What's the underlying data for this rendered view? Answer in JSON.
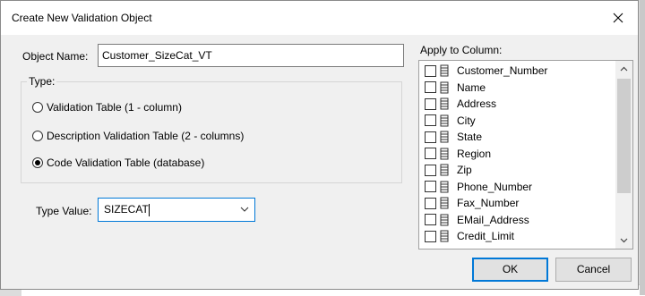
{
  "dialog": {
    "title": "Create New Validation Object"
  },
  "object_name": {
    "label": "Object Name:",
    "value": "Customer_SizeCat_VT"
  },
  "type_group": {
    "label": "Type:",
    "options": [
      {
        "label": "Validation Table (1 - column)",
        "checked": false
      },
      {
        "label": "Description Validation Table (2 - columns)",
        "checked": false
      },
      {
        "label": "Code Validation Table (database)",
        "checked": true
      }
    ]
  },
  "type_value": {
    "label": "Type Value:",
    "value": "SIZECAT"
  },
  "apply_to_column": {
    "label": "Apply to Column:",
    "items": [
      {
        "label": "Customer_Number",
        "checked": false
      },
      {
        "label": "Name",
        "checked": false
      },
      {
        "label": "Address",
        "checked": false
      },
      {
        "label": "City",
        "checked": false
      },
      {
        "label": "State",
        "checked": false
      },
      {
        "label": "Region",
        "checked": false
      },
      {
        "label": "Zip",
        "checked": false
      },
      {
        "label": "Phone_Number",
        "checked": false
      },
      {
        "label": "Fax_Number",
        "checked": false
      },
      {
        "label": "EMail_Address",
        "checked": false
      },
      {
        "label": "Credit_Limit",
        "checked": false
      }
    ]
  },
  "buttons": {
    "ok": "OK",
    "cancel": "Cancel"
  },
  "icons": {
    "close": "close-icon",
    "column": "column-icon",
    "dropdown": "chevron-down-icon",
    "scroll_up": "chevron-up-icon",
    "scroll_down": "chevron-down-icon"
  },
  "colors": {
    "accent": "#0078d7",
    "dialog_bg": "#f0f0f0",
    "titlebar_bg": "#ffffff"
  }
}
